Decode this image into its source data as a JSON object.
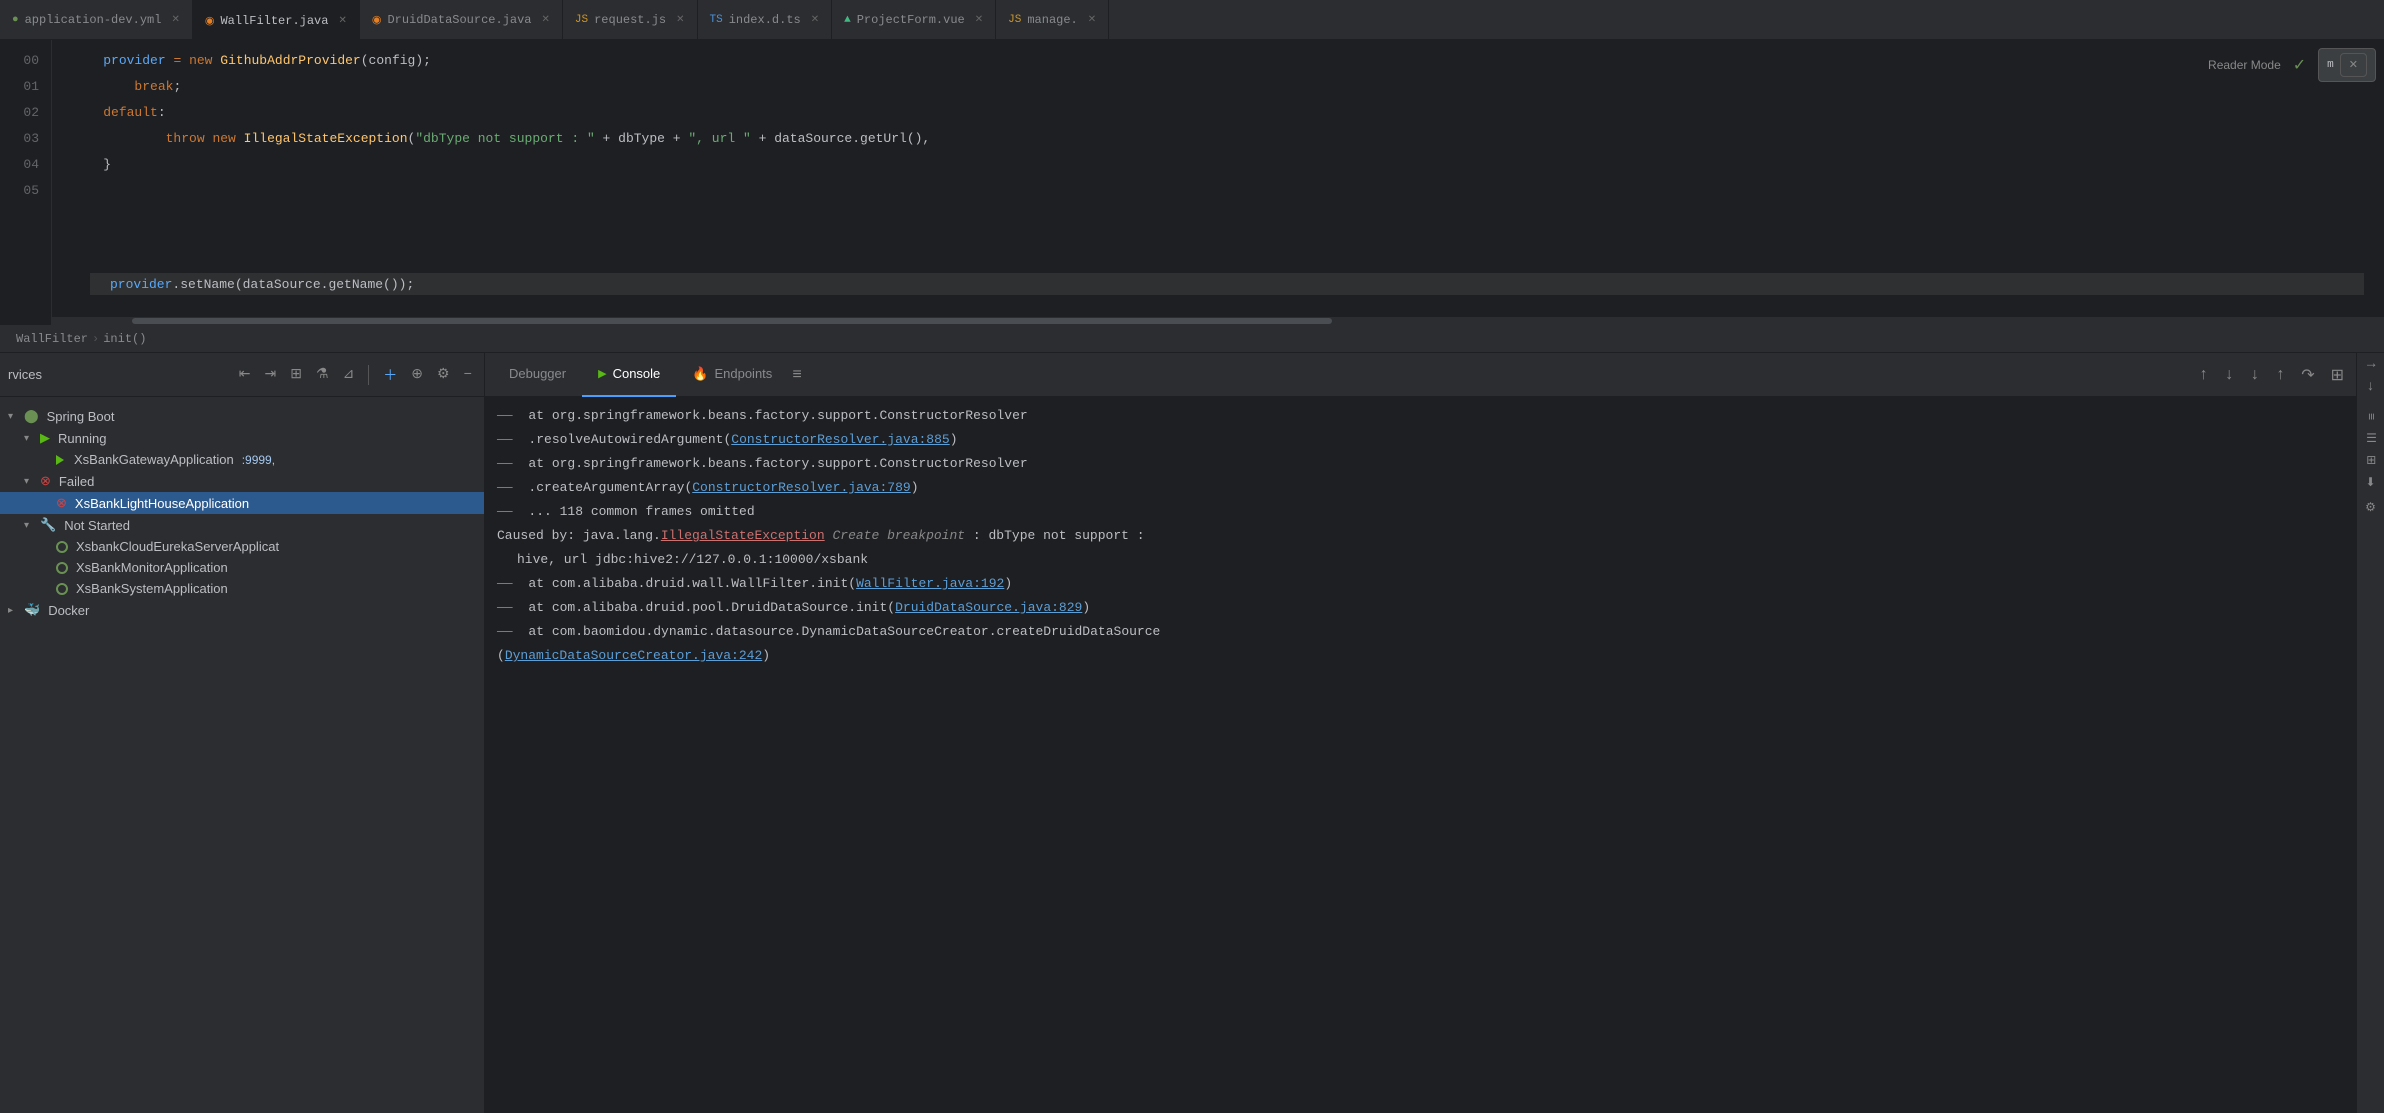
{
  "tabs": [
    {
      "id": "application-dev",
      "label": "application-dev.yml",
      "icon": "yml",
      "active": false
    },
    {
      "id": "wallfilter",
      "label": "WallFilter.java",
      "icon": "java",
      "active": true
    },
    {
      "id": "druiddatasource",
      "label": "DruidDataSource.java",
      "icon": "java",
      "active": false
    },
    {
      "id": "request-js",
      "label": "request.js",
      "icon": "js",
      "active": false
    },
    {
      "id": "index-d-ts",
      "label": "index.d.ts",
      "icon": "ts",
      "active": false
    },
    {
      "id": "projectform-vue",
      "label": "ProjectForm.vue",
      "icon": "vue",
      "active": false
    },
    {
      "id": "manage",
      "label": "manage.",
      "icon": "js",
      "active": false
    }
  ],
  "editor": {
    "lines": [
      {
        "num": "00",
        "code": "    provider = new GithubAddrProvider(config);",
        "highlight": false
      },
      {
        "num": "01",
        "code": "        break;",
        "highlight": false
      },
      {
        "num": "02",
        "code": "    default:",
        "highlight": false
      },
      {
        "num": "03",
        "code": "            throw new IllegalStateException(\"dbType not support : \" + dbType + \", url \" + dataSource.getUrl(),",
        "highlight": false
      },
      {
        "num": "04",
        "code": "    }",
        "highlight": false
      },
      {
        "num": "05",
        "code": "",
        "highlight": false
      }
    ],
    "scroll_line": "provider.setName(dataSource.getName());",
    "reader_mode_label": "Reader Mode",
    "check_symbol": "✓",
    "mini_popup_text": "m"
  },
  "breadcrumb": {
    "items": [
      "WallFilter",
      "init()"
    ]
  },
  "services_panel": {
    "title": "rvices",
    "toolbar_items": [
      "collapse-all",
      "expand-all",
      "group",
      "filter",
      "sort",
      "add"
    ],
    "tree": [
      {
        "level": 0,
        "expanded": true,
        "icon": "spring-boot",
        "label": "Spring Boot",
        "type": "group"
      },
      {
        "level": 1,
        "expanded": true,
        "icon": "run",
        "label": "Running",
        "type": "group"
      },
      {
        "level": 2,
        "expanded": false,
        "icon": "play",
        "label": "XsBankGatewayApplication",
        "port": ":9999,",
        "type": "app-running"
      },
      {
        "level": 1,
        "expanded": true,
        "icon": "fail",
        "label": "Failed",
        "type": "group"
      },
      {
        "level": 2,
        "expanded": false,
        "icon": "fail",
        "label": "XsBankLightHouseApplication",
        "type": "app-failed",
        "selected": true
      },
      {
        "level": 1,
        "expanded": true,
        "icon": "not-started",
        "label": "Not Started",
        "type": "group"
      },
      {
        "level": 2,
        "expanded": false,
        "icon": "not-started",
        "label": "XsbankCloudEurekaServerApplicat",
        "type": "app"
      },
      {
        "level": 2,
        "expanded": false,
        "icon": "not-started",
        "label": "XsBankMonitorApplication",
        "type": "app"
      },
      {
        "level": 2,
        "expanded": false,
        "icon": "not-started",
        "label": "XsBankSystemApplication",
        "type": "app"
      },
      {
        "level": 0,
        "expanded": false,
        "icon": "docker",
        "label": "Docker",
        "type": "group"
      }
    ]
  },
  "debugger_panel": {
    "tabs": [
      {
        "id": "debugger",
        "label": "Debugger",
        "icon": "",
        "active": false
      },
      {
        "id": "console",
        "label": "Console",
        "icon": "▶",
        "active": true
      },
      {
        "id": "endpoints",
        "label": "Endpoints",
        "icon": "🔥",
        "active": false
      }
    ],
    "console_lines": [
      {
        "type": "dash-text",
        "dash": "——",
        "text": " at org.springframework.beans.factory.support.ConstructorResolver"
      },
      {
        "type": "dash-text",
        "dash": "——",
        "text": " .resolveAutowiredArgument(",
        "link": "ConstructorResolver.java:885",
        "link_url": "ConstructorResolver.java:885",
        "after": ")"
      },
      {
        "type": "dash-text",
        "dash": "——",
        "text": " at org.springframework.beans.factory.support.ConstructorResolver"
      },
      {
        "type": "dash-text",
        "dash": "——",
        "text": " .createArgumentArray(",
        "link": "ConstructorResolver.java:789",
        "link_url": "ConstructorResolver.java:789",
        "after": ")"
      },
      {
        "type": "dash-text",
        "dash": "——",
        "text": " ... 118 common frames omitted"
      },
      {
        "type": "caused-by",
        "prefix": "Caused by: ",
        "exception": "java.lang.IllegalStateException",
        "middle": " Create breakpoint ",
        "message": ": dbType not support :"
      },
      {
        "type": "plain",
        "text": "  hive, url jdbc:hive2://127.0.0.1:10000/xsbank"
      },
      {
        "type": "dash-link",
        "dash": "——",
        "prefix": " at com.alibaba.druid.wall.WallFilter.init(",
        "link": "WallFilter.java:192",
        "after": ")"
      },
      {
        "type": "dash-link",
        "dash": "——",
        "prefix": " at com.alibaba.druid.pool.DruidDataSource.init(",
        "link": "DruidDataSource.java:829",
        "after": ")"
      },
      {
        "type": "dash-text",
        "dash": "——",
        "text": " at com.baomidou.dynamic.datasource.DynamicDataSourceCreator.createDruidDataSource"
      },
      {
        "type": "dash-link",
        "dash": "",
        "prefix": "(",
        "link": "DynamicDataSourceCreator.java:242",
        "after": ")"
      }
    ]
  }
}
